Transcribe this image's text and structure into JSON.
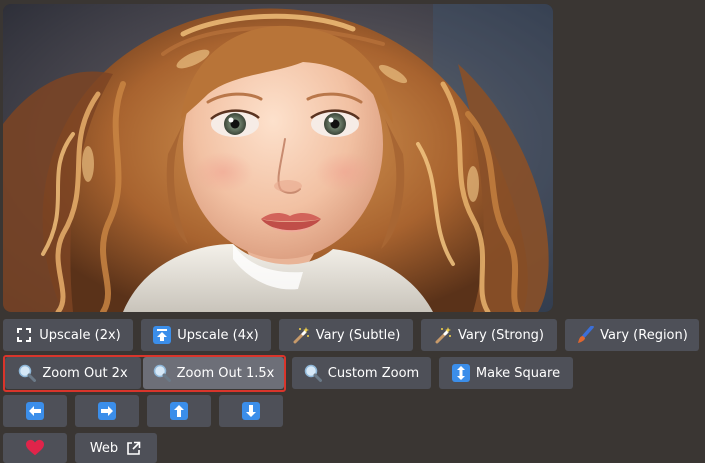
{
  "image": {
    "alt_semantic": "generated-portrait"
  },
  "colors": {
    "page_bg": "#3a3633",
    "button_bg": "#4e5058",
    "button_pressed_bg": "#6d6f78",
    "highlight_border": "#d9352b",
    "blue_icon": "#3b8eea",
    "heart": "#e0244a"
  },
  "rows": {
    "row1": {
      "upscale_2x": {
        "label": "Upscale (2x)",
        "icon": "expand-icon"
      },
      "upscale_4x": {
        "label": "Upscale (4x)",
        "icon": "arrow-up-bar-icon"
      },
      "vary_subtle": {
        "label": "Vary (Subtle)",
        "icon": "magic-wand-icon"
      },
      "vary_strong": {
        "label": "Vary (Strong)",
        "icon": "magic-wand-icon"
      },
      "vary_region": {
        "label": "Vary (Region)",
        "icon": "paintbrush-icon"
      }
    },
    "row2": {
      "zoom_out_2x": {
        "label": "Zoom Out 2x",
        "icon": "magnifier-icon"
      },
      "zoom_out_1_5x": {
        "label": "Zoom Out 1.5x",
        "icon": "magnifier-icon"
      },
      "custom_zoom": {
        "label": "Custom Zoom",
        "icon": "magnifier-icon"
      },
      "make_square": {
        "label": "Make Square",
        "icon": "up-down-arrow-icon"
      }
    },
    "row3": {
      "pan_left": {
        "icon": "arrow-left-icon"
      },
      "pan_right": {
        "icon": "arrow-right-icon"
      },
      "pan_up": {
        "icon": "arrow-up-icon"
      },
      "pan_down": {
        "icon": "arrow-down-icon"
      }
    },
    "row4": {
      "favorite": {
        "icon": "heart-icon"
      },
      "web": {
        "label": "Web",
        "icon": "external-link-icon"
      }
    }
  }
}
